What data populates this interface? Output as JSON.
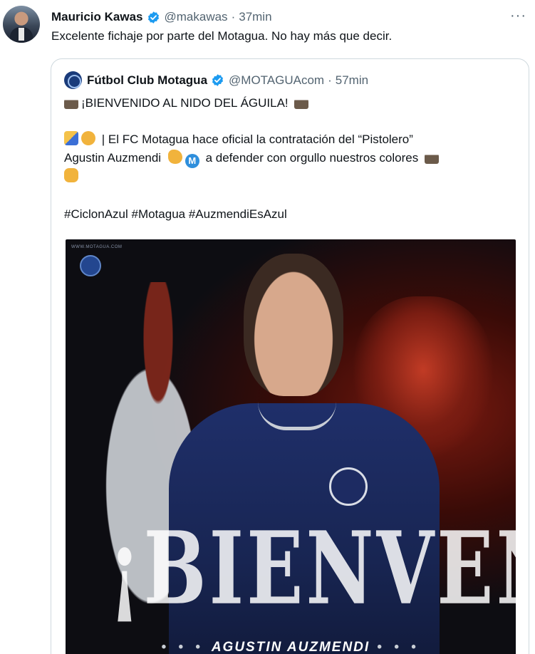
{
  "tweet": {
    "author_name": "Mauricio Kawas",
    "handle": "@makawas",
    "separator": "·",
    "time": "37min",
    "more_label": "···",
    "text": "Excelente fichaje por parte del Motagua. No hay más que decir."
  },
  "quoted": {
    "author_name": "Fútbol Club Motagua",
    "handle": "@MOTAGUAcom",
    "separator": "·",
    "time": "57min",
    "line1": "¡BIENVENIDO AL NIDO DEL ÁGUILA!",
    "line2": "| El FC Motagua hace oficial la contratación del “Pistolero”",
    "line3a": "Agustin Auzmendi",
    "line3b": "a defender con orgullo nuestros colores",
    "hashtags": "#CiclonAzul #Motagua #AuzmendiEsAzul",
    "icons": [
      "eagle-emoji",
      "writing-hand-emoji",
      "handshake-emoji",
      "pointing-hand-emoji",
      "m-circle-emoji",
      "fist-emoji"
    ],
    "image": {
      "site_tag": "WWW.MOTAGUA.COM",
      "headline": "¡BIENVENIDO!",
      "player_name": "AGUSTIN AUZMENDI",
      "name_dots": "• • •"
    }
  },
  "colors": {
    "verified_blue": "#1d9bf0",
    "secondary_text": "#536471",
    "border": "#cfd9de"
  }
}
